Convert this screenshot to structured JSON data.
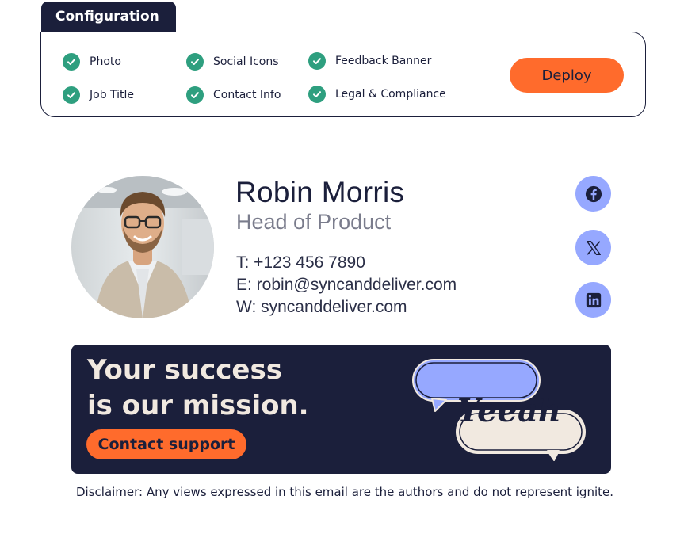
{
  "config": {
    "tab_label": "Configuration",
    "options": [
      {
        "label": "Photo",
        "checked": true
      },
      {
        "label": "Job Title",
        "checked": true
      },
      {
        "label": "Social Icons",
        "checked": true
      },
      {
        "label": "Contact Info",
        "checked": true
      },
      {
        "label": "Feedback Banner",
        "checked": true
      },
      {
        "label": "Legal & Compliance",
        "checked": true
      }
    ],
    "deploy_label": "Deploy"
  },
  "signature": {
    "name": "Robin Morris",
    "title": "Head of Product",
    "phone": "T: +123 456 7890",
    "email": "E: robin@syncanddeliver.com",
    "web": "W: syncanddeliver.com",
    "social": [
      "facebook-icon",
      "x-icon",
      "linkedin-icon"
    ]
  },
  "banner": {
    "line1": "Your success",
    "line2": "is our mission.",
    "cta": "Contact support",
    "graphic_word": "Yeeah"
  },
  "disclaimer": "Disclaimer: Any views expressed in this email are the authors and do not represent ignite.",
  "colors": {
    "navy": "#1b1f3b",
    "orange": "#ff6b2c",
    "green_check": "#2e9f7f",
    "periwinkle": "#96a8ff",
    "cream": "#f1e9e0",
    "muted": "#7a7c8c"
  }
}
